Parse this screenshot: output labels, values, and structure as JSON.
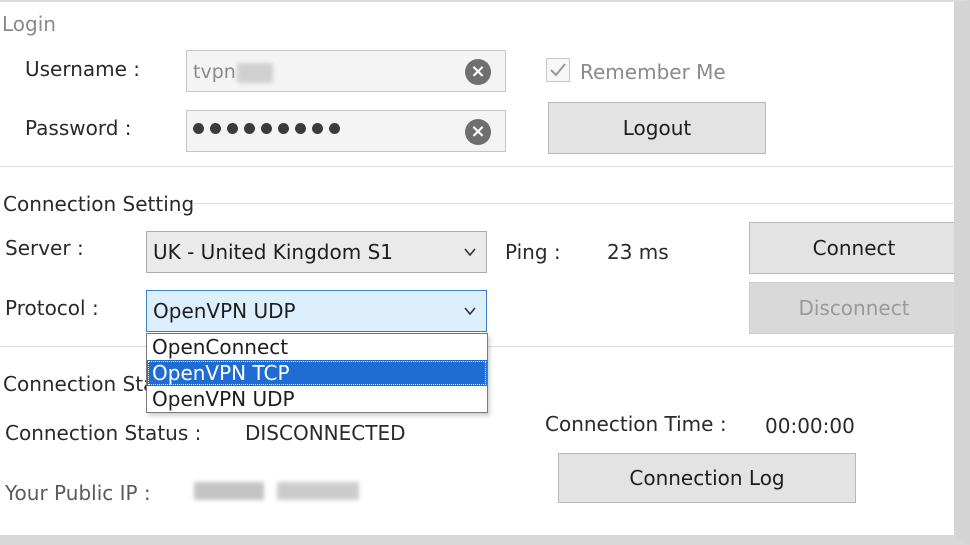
{
  "login": {
    "section_title": "Login",
    "username_label": "Username :",
    "username_value": "tvpn",
    "password_label": "Password :",
    "remember_me": "Remember Me",
    "remember_checked": true,
    "logout_label": "Logout"
  },
  "connection_setting": {
    "section_title": "Connection Setting",
    "server_label": "Server :",
    "server_value": "UK - United Kingdom S1",
    "ping_label": "Ping :",
    "ping_value": "23 ms",
    "protocol_label": "Protocol :",
    "protocol_value": "OpenVPN UDP",
    "protocol_options": [
      "OpenConnect",
      "OpenVPN TCP",
      "OpenVPN UDP"
    ],
    "protocol_highlighted": "OpenVPN TCP",
    "connect_label": "Connect",
    "disconnect_label": "Disconnect"
  },
  "connection_status": {
    "section_title": "Connection Sta",
    "status_label": "Connection Status :",
    "status_value": "DISCONNECTED",
    "time_label": "Connection Time :",
    "time_value": "00:00:00",
    "public_ip_label": "Your Public IP :",
    "log_label": "Connection Log"
  }
}
